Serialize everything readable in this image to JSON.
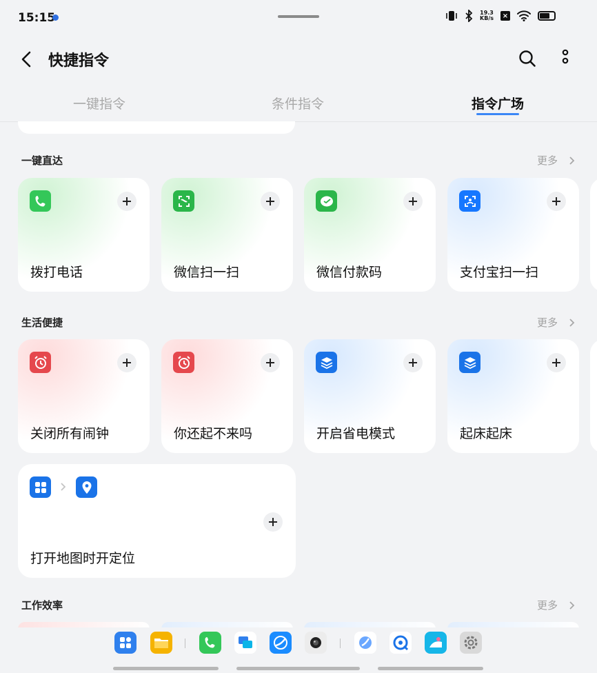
{
  "status": {
    "time": "15:15",
    "speed_top": "19.3",
    "speed_bottom": "KB/s"
  },
  "header": {
    "title": "快捷指令"
  },
  "tabs": [
    {
      "label": "一键指令"
    },
    {
      "label": "条件指令"
    },
    {
      "label": "指令广场"
    }
  ],
  "sections": [
    {
      "title": "一键直达",
      "more": "更多",
      "cards": [
        {
          "label": "拨打电话",
          "icon": "phone-icon",
          "color": "#34c759"
        },
        {
          "label": "微信扫一扫",
          "icon": "scan-icon",
          "color": "#2bb64a"
        },
        {
          "label": "微信付款码",
          "icon": "wechat-pay-icon",
          "color": "#2bb64a"
        },
        {
          "label": "支付宝扫一扫",
          "icon": "alipay-scan-icon",
          "color": "#1677ff"
        }
      ]
    },
    {
      "title": "生活便捷",
      "more": "更多",
      "cards": [
        {
          "label": "关闭所有闹钟",
          "icon": "alarm-icon",
          "color": "#e5484d"
        },
        {
          "label": "你还起不来吗",
          "icon": "alarm-icon",
          "color": "#e5484d"
        },
        {
          "label": "开启省电模式",
          "icon": "layers-icon",
          "color": "#1a73e8"
        },
        {
          "label": "起床起床",
          "icon": "layers-icon",
          "color": "#1a73e8"
        }
      ],
      "wide_card": {
        "label": "打开地图时开定位"
      }
    },
    {
      "title": "工作效率",
      "more": "更多"
    }
  ]
}
